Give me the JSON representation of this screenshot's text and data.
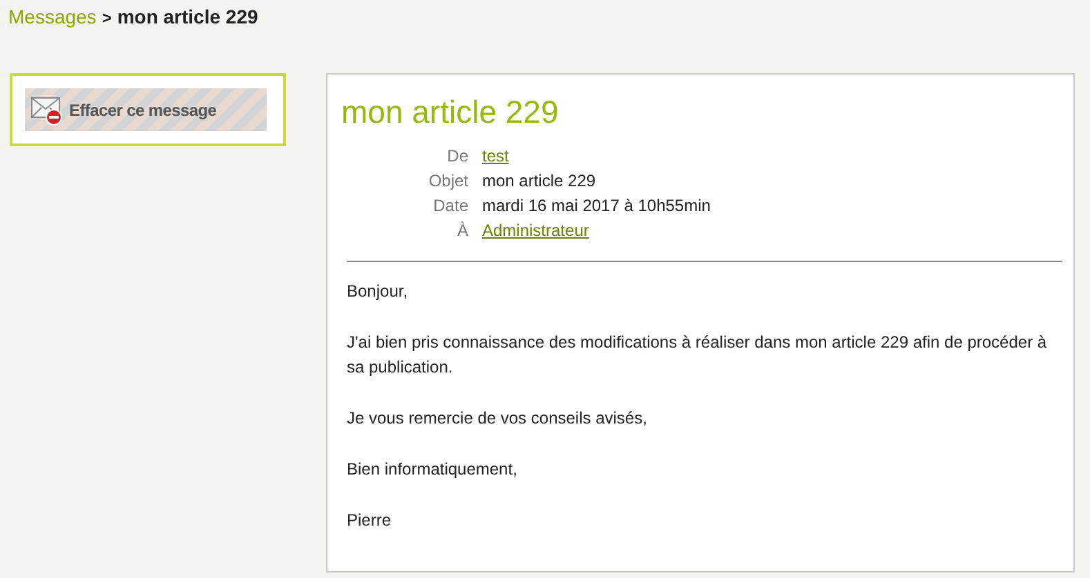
{
  "breadcrumb": {
    "parent": "Messages",
    "separator": ">",
    "current": "mon article 229"
  },
  "actions": [
    {
      "label": "Effacer ce message"
    }
  ],
  "message": {
    "title": "mon article 229",
    "headers": [
      {
        "label": "De",
        "value": "test",
        "kind": "link"
      },
      {
        "label": "Objet",
        "value": "mon article 229",
        "kind": "text"
      },
      {
        "label": "Date",
        "value": "mardi 16 mai 2017 à 10h55min",
        "kind": "text"
      },
      {
        "label": "À",
        "value": "Administrateur",
        "kind": "link"
      }
    ],
    "body": [
      "Bonjour,",
      "J'ai bien pris connaissance des modifications à réaliser dans mon article 229 afin de procéder à sa publication.",
      "Je vous remercie de vos conseils avisés,",
      "Bien informatiquement,",
      "Pierre"
    ]
  }
}
